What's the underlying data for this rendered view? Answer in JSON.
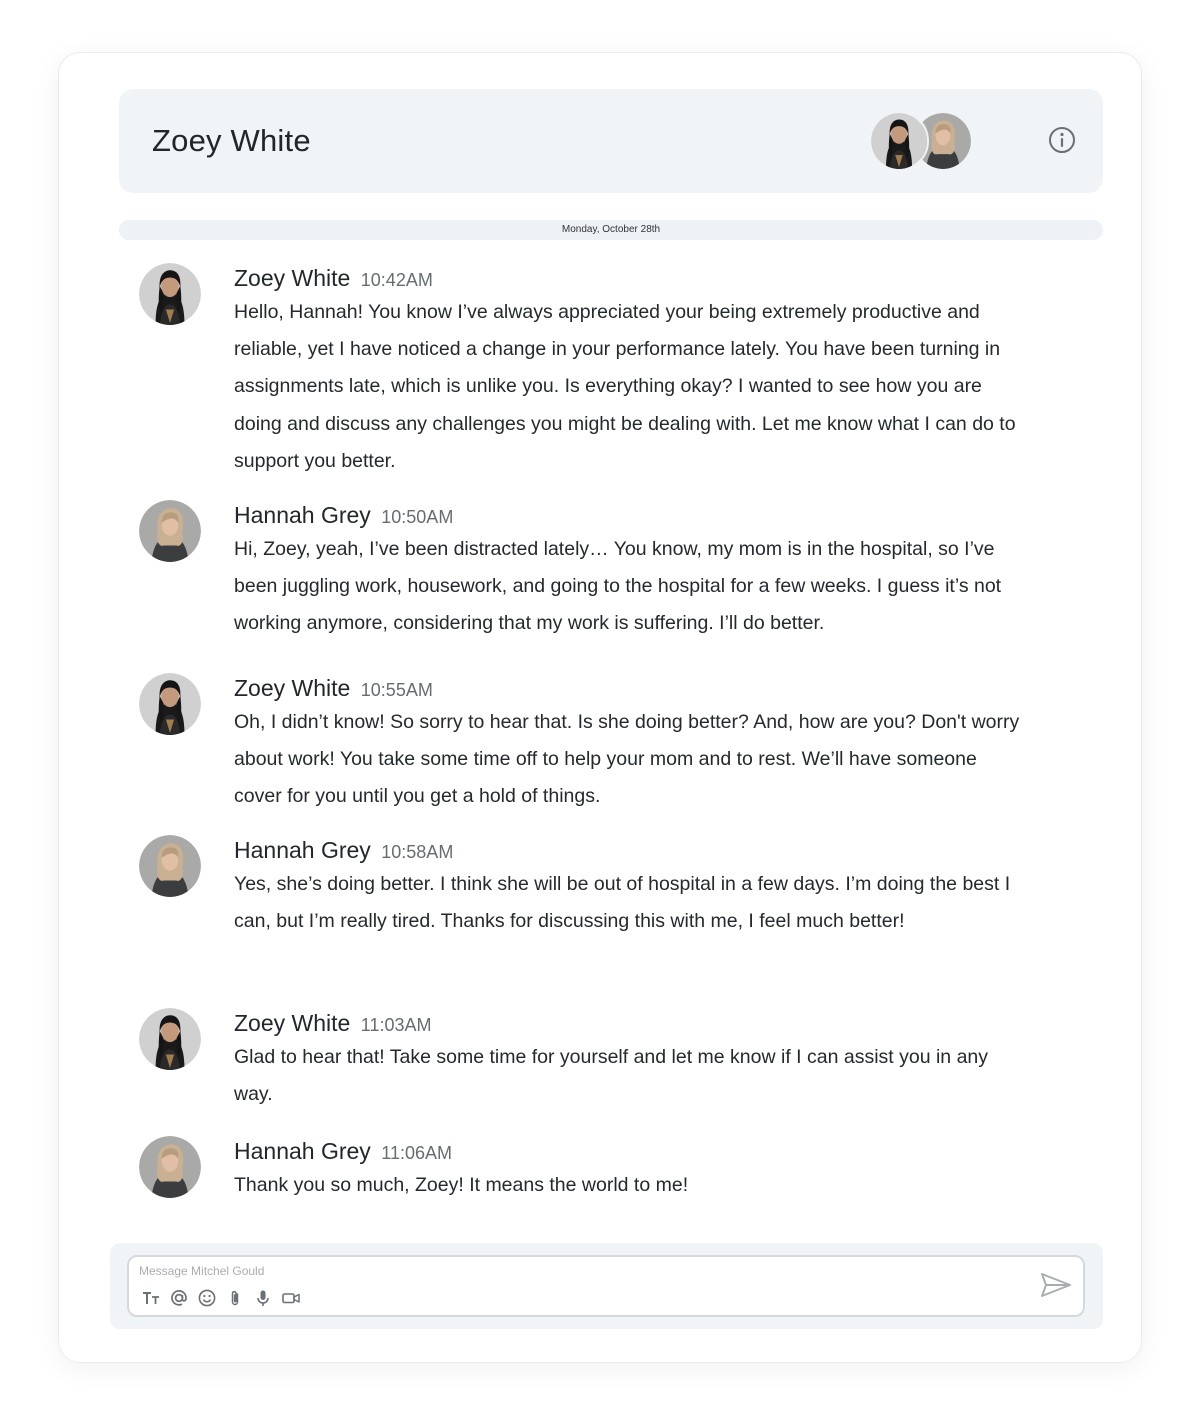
{
  "header": {
    "title": "Zoey White"
  },
  "date_divider": "Monday, October 28th",
  "messages": [
    {
      "author": "Zoey White",
      "time": "10:42AM",
      "text": "Hello, Hannah! You know I’ve always appreciated your being extremely productive and reliable, yet I have noticed a change in your performance lately. You have been turning in assignments late, which is unlike you. Is everything okay? I wanted to see how you are doing and discuss any challenges you might be dealing with. Let me know what I can do to support you better."
    },
    {
      "author": "Hannah Grey",
      "time": "10:50AM",
      "text": "Hi, Zoey, yeah, I’ve been distracted lately… You know, my mom is in the hospital, so I’ve been juggling work, housework, and going to the hospital for a few weeks. I guess it’s not working anymore, considering that my work is suffering. I’ll do better."
    },
    {
      "author": "Zoey White",
      "time": "10:55AM",
      "text": "Oh, I didn’t know! So sorry to hear that. Is she doing better? And, how are you? Don't worry about work! You take some time off to help your mom and to rest. We’ll have someone cover for you until you get a hold of things."
    },
    {
      "author": "Hannah Grey",
      "time": "10:58AM",
      "text": "Yes, she’s doing better. I think she will be out of hospital in a few days. I’m doing the best I can, but I’m really tired. Thanks for discussing this with me, I feel much better!"
    },
    {
      "author": "Zoey White",
      "time": "11:03AM",
      "text": "Glad to hear that! Take some time for yourself and let me know if I can assist you in any way."
    },
    {
      "author": "Hannah Grey",
      "time": "11:06AM",
      "text": "Thank you so much, Zoey! It means the world to me!"
    }
  ],
  "composer": {
    "placeholder": "Message Mitchel Gould",
    "tools": [
      "text-format-icon",
      "mention-icon",
      "emoji-icon",
      "attachment-icon",
      "microphone-icon",
      "video-icon"
    ],
    "send_icon": "send-icon"
  },
  "colors": {
    "header_bg": "#f1f4f7",
    "text": "#25292e",
    "muted": "#676c73",
    "icon": "#6b7077"
  }
}
